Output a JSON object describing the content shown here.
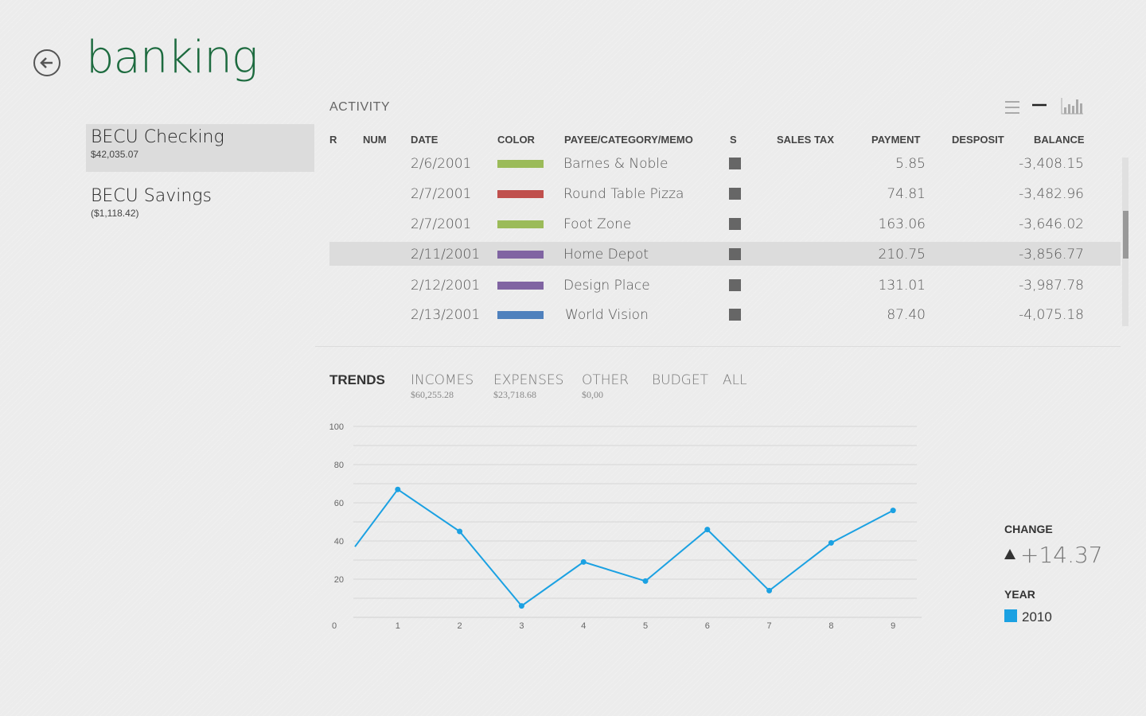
{
  "header": {
    "title": "banking",
    "back_icon": "back-arrow-icon"
  },
  "accounts": [
    {
      "name": "BECU Checking",
      "balance": "$42,035.07",
      "selected": true
    },
    {
      "name": "BECU Savings",
      "balance": "($1,118.42)",
      "selected": false
    }
  ],
  "activity": {
    "title": "ACTIVITY",
    "view_icons": [
      "list-view-icon",
      "line-view-icon",
      "chart-view-icon"
    ],
    "columns": [
      "R",
      "NUM",
      "DATE",
      "COLOR",
      "PAYEE/CATEGORY/MEMO",
      "S",
      "SALES TAX",
      "PAYMENT",
      "DESPOSIT",
      "BALANCE"
    ],
    "rows": [
      {
        "date": "2/6/2001",
        "color": "#9bbb59",
        "payee": "Barnes & Noble",
        "payment": "5.85",
        "balance": "-3,408.15"
      },
      {
        "date": "2/7/2001",
        "color": "#c0504d",
        "payee": "Round Table Pizza",
        "payment": "74.81",
        "balance": "-3,482.96"
      },
      {
        "date": "2/7/2001",
        "color": "#9bbb59",
        "payee": "Foot Zone",
        "payment": "163.06",
        "balance": "-3,646.02"
      },
      {
        "date": "2/11/2001",
        "color": "#8064a2",
        "payee": "Home Depot",
        "payment": "210.75",
        "balance": "-3,856.77"
      },
      {
        "date": "2/12/2001",
        "color": "#8064a2",
        "payee": "Design Place",
        "payment": "131.01",
        "balance": "-3,987.78"
      },
      {
        "date": "2/13/2001",
        "color": "#4f81bd",
        "payee": "World Vision",
        "payment": "87.40",
        "balance": "-4,075.18"
      }
    ],
    "highlighted_row": 3
  },
  "trends": {
    "tabs": [
      {
        "label": "TRENDS",
        "sub": ""
      },
      {
        "label": "INCOMES",
        "sub": "$60,255.28"
      },
      {
        "label": "EXPENSES",
        "sub": "$23,718.68"
      },
      {
        "label": "OTHER",
        "sub": "$0,00"
      },
      {
        "label": "BUDGET",
        "sub": ""
      },
      {
        "label": "ALL",
        "sub": ""
      }
    ],
    "change_label": "CHANGE",
    "change_value": "+14.37",
    "year_label": "YEAR",
    "year_item": "2010",
    "year_color": "#1ba1e2"
  },
  "chart_data": {
    "type": "line",
    "x": [
      0,
      1,
      2,
      3,
      4,
      5,
      6,
      7,
      8,
      9
    ],
    "x_ticks": [
      "0",
      "1",
      "2",
      "3",
      "4",
      "5",
      "6",
      "7",
      "8",
      "9"
    ],
    "y_ticks": [
      "20",
      "40",
      "60",
      "80",
      "100"
    ],
    "ylim": [
      0,
      100
    ],
    "series": [
      {
        "name": "2010",
        "color": "#1ba1e2",
        "points": [
          [
            0.3,
            37
          ],
          [
            1,
            67
          ],
          [
            2,
            45
          ],
          [
            3,
            6
          ],
          [
            4,
            29
          ],
          [
            5,
            19
          ],
          [
            6,
            46
          ],
          [
            7,
            14
          ],
          [
            8,
            39
          ],
          [
            9,
            56
          ]
        ]
      }
    ],
    "grid": true
  }
}
